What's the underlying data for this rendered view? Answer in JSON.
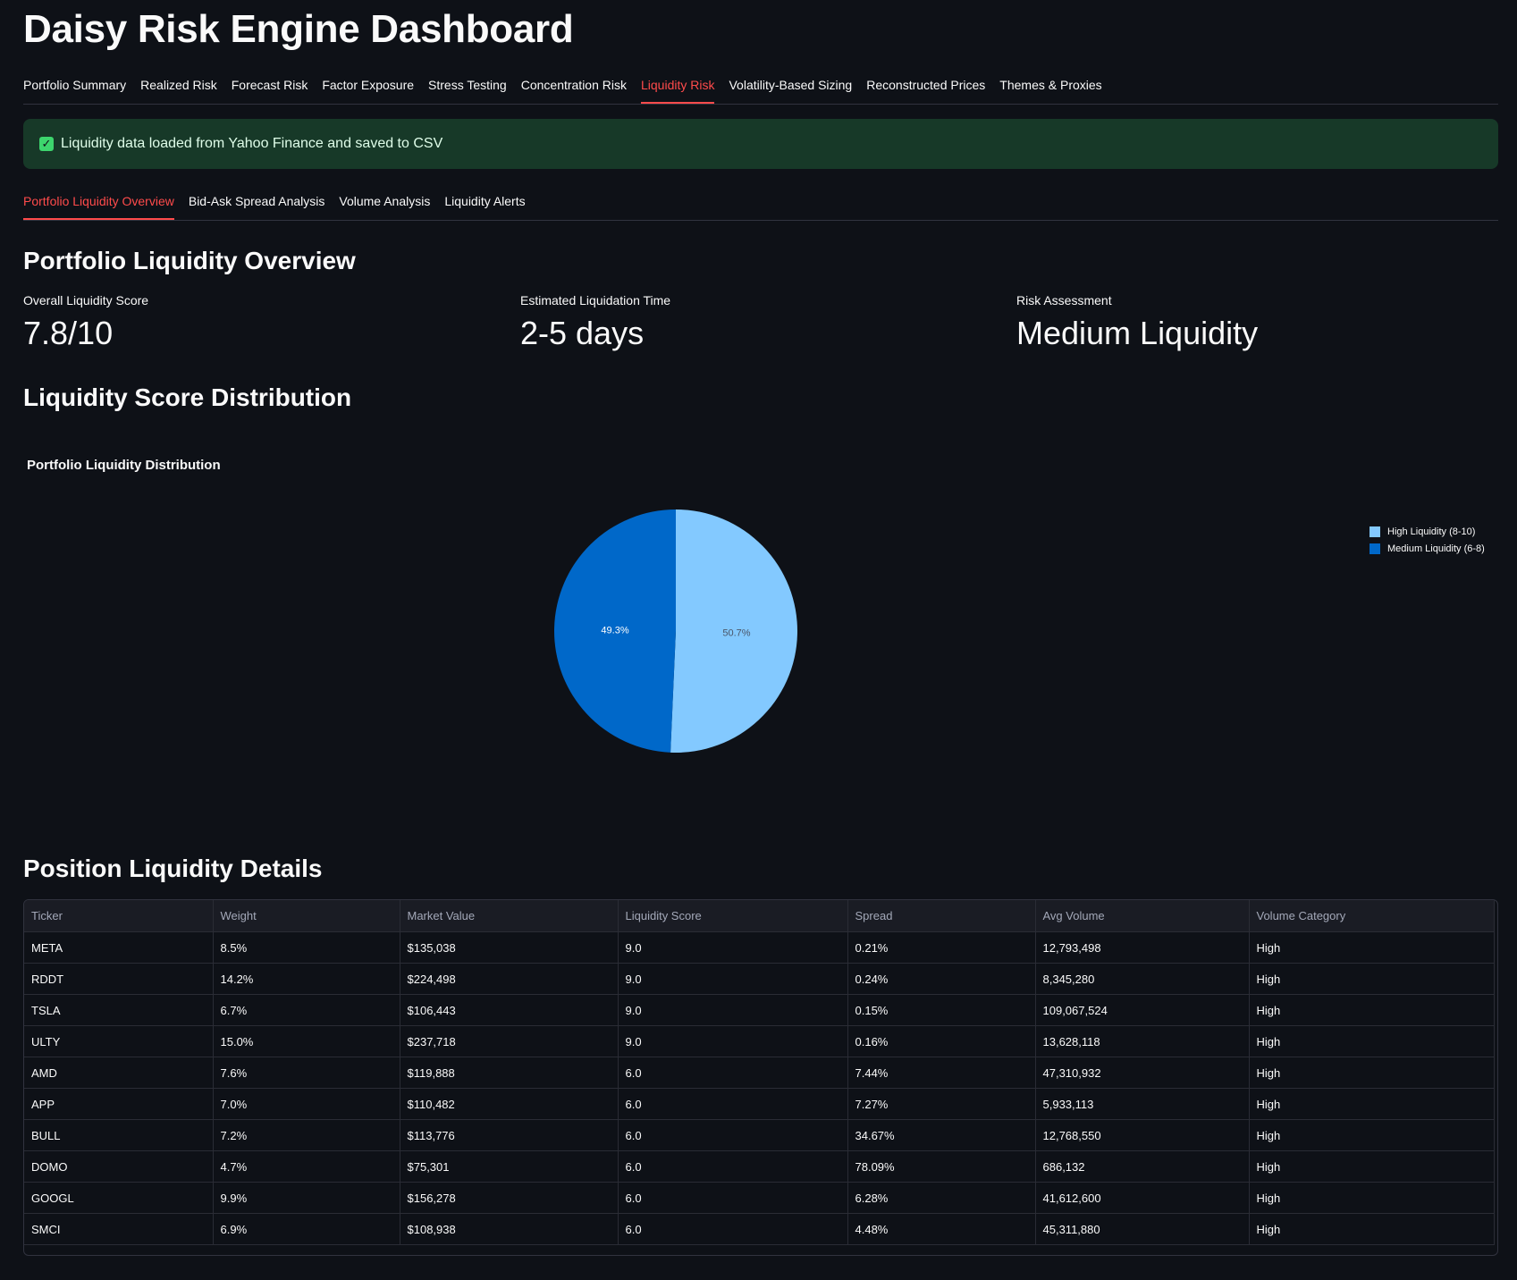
{
  "app_title": "Daisy Risk Engine Dashboard",
  "main_tabs": [
    {
      "label": "Portfolio Summary",
      "active": false
    },
    {
      "label": "Realized Risk",
      "active": false
    },
    {
      "label": "Forecast Risk",
      "active": false
    },
    {
      "label": "Factor Exposure",
      "active": false
    },
    {
      "label": "Stress Testing",
      "active": false
    },
    {
      "label": "Concentration Risk",
      "active": false
    },
    {
      "label": "Liquidity Risk",
      "active": true
    },
    {
      "label": "Volatility-Based Sizing",
      "active": false
    },
    {
      "label": "Reconstructed Prices",
      "active": false
    },
    {
      "label": "Themes & Proxies",
      "active": false
    }
  ],
  "alert": {
    "icon": "check-icon",
    "text": "Liquidity data loaded from Yahoo Finance and saved to CSV",
    "color": "#173928"
  },
  "sub_tabs": [
    {
      "label": "Portfolio Liquidity Overview",
      "active": true
    },
    {
      "label": "Bid-Ask Spread Analysis",
      "active": false
    },
    {
      "label": "Volume Analysis",
      "active": false
    },
    {
      "label": "Liquidity Alerts",
      "active": false
    }
  ],
  "overview": {
    "heading": "Portfolio Liquidity Overview",
    "metrics": [
      {
        "label": "Overall Liquidity Score",
        "value": "7.8/10"
      },
      {
        "label": "Estimated Liquidation Time",
        "value": "2-5 days"
      },
      {
        "label": "Risk Assessment",
        "value": "Medium Liquidity"
      }
    ]
  },
  "distribution": {
    "heading": "Liquidity Score Distribution"
  },
  "chart_data": {
    "type": "pie",
    "title": "Portfolio Liquidity Distribution",
    "slices": [
      {
        "name": "High Liquidity (8-10)",
        "value": 50.7,
        "label": "50.7%",
        "color": "#83c9ff"
      },
      {
        "name": "Medium Liquidity (6-8)",
        "value": 49.3,
        "label": "49.3%",
        "color": "#0068c9"
      }
    ],
    "legend": "top-right"
  },
  "details": {
    "heading": "Position Liquidity Details",
    "columns": [
      "Ticker",
      "Weight",
      "Market Value",
      "Liquidity Score",
      "Spread",
      "Avg Volume",
      "Volume Category"
    ],
    "rows": [
      [
        "META",
        "8.5%",
        "$135,038",
        "9.0",
        "0.21%",
        "12,793,498",
        "High"
      ],
      [
        "RDDT",
        "14.2%",
        "$224,498",
        "9.0",
        "0.24%",
        "8,345,280",
        "High"
      ],
      [
        "TSLA",
        "6.7%",
        "$106,443",
        "9.0",
        "0.15%",
        "109,067,524",
        "High"
      ],
      [
        "ULTY",
        "15.0%",
        "$237,718",
        "9.0",
        "0.16%",
        "13,628,118",
        "High"
      ],
      [
        "AMD",
        "7.6%",
        "$119,888",
        "6.0",
        "7.44%",
        "47,310,932",
        "High"
      ],
      [
        "APP",
        "7.0%",
        "$110,482",
        "6.0",
        "7.27%",
        "5,933,113",
        "High"
      ],
      [
        "BULL",
        "7.2%",
        "$113,776",
        "6.0",
        "34.67%",
        "12,768,550",
        "High"
      ],
      [
        "DOMO",
        "4.7%",
        "$75,301",
        "6.0",
        "78.09%",
        "686,132",
        "High"
      ],
      [
        "GOOGL",
        "9.9%",
        "$156,278",
        "6.0",
        "6.28%",
        "41,612,600",
        "High"
      ],
      [
        "SMCI",
        "6.9%",
        "$108,938",
        "6.0",
        "4.48%",
        "45,311,880",
        "High"
      ]
    ]
  }
}
